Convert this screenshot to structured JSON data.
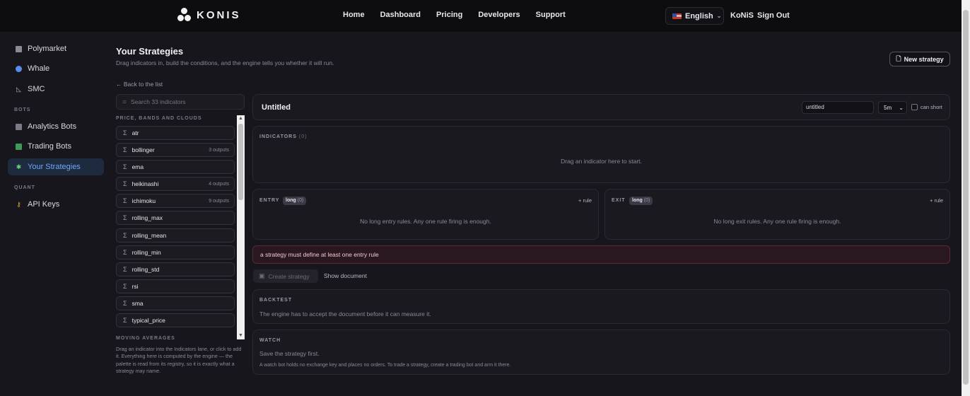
{
  "topbar": {
    "logo_text": "KONIS",
    "nav": [
      "Home",
      "Dashboard",
      "Pricing",
      "Developers",
      "Support"
    ],
    "language": "English",
    "user": "KoNiS",
    "sign_out": "Sign Out"
  },
  "sidebar": {
    "items_top": [
      {
        "label": "Polymarket",
        "icon": "polymarket-icon"
      },
      {
        "label": "Whale",
        "icon": "whale-icon"
      },
      {
        "label": "SMC",
        "icon": "smc-icon"
      }
    ],
    "section_bots": "BOTS",
    "items_bots": [
      {
        "label": "Analytics Bots",
        "icon": "analytics-icon"
      },
      {
        "label": "Trading Bots",
        "icon": "trading-icon"
      },
      {
        "label": "Your Strategies",
        "icon": "puzzle-icon",
        "active": true
      }
    ],
    "section_quant": "QUANT",
    "items_quant": [
      {
        "label": "API Keys",
        "icon": "key-icon"
      }
    ]
  },
  "header": {
    "title": "Your Strategies",
    "subtitle": "Drag indicators in, build the conditions, and the engine tells you whether it will run.",
    "back": "← Back to the list",
    "new_strategy": "New strategy"
  },
  "palette": {
    "search_placeholder": "Search 33 indicators",
    "group1": "PRICE, BANDS AND CLOUDS",
    "indicators": [
      {
        "name": "atr",
        "outputs": ""
      },
      {
        "name": "bollinger",
        "outputs": "3 outputs"
      },
      {
        "name": "ema",
        "outputs": ""
      },
      {
        "name": "heikinashi",
        "outputs": "4 outputs"
      },
      {
        "name": "ichimoku",
        "outputs": "9 outputs"
      },
      {
        "name": "rolling_max",
        "outputs": ""
      },
      {
        "name": "rolling_mean",
        "outputs": ""
      },
      {
        "name": "rolling_min",
        "outputs": ""
      },
      {
        "name": "rolling_std",
        "outputs": ""
      },
      {
        "name": "rsi",
        "outputs": ""
      },
      {
        "name": "sma",
        "outputs": ""
      },
      {
        "name": "typical_price",
        "outputs": ""
      }
    ],
    "group2": "MOVING AVERAGES",
    "note": "Drag an indicator into the Indicators lane, or click to add it. Everything here is computed by the engine — the palette is read from its registry, so it is exactly what a strategy may name."
  },
  "editor": {
    "name": "Untitled",
    "name_input": "untitled",
    "timeframe": "5m",
    "can_short": "can short",
    "indicators_label": "INDICATORS",
    "indicators_count": "(0)",
    "indicators_empty": "Drag an indicator here to start.",
    "entry_label": "ENTRY",
    "exit_label": "EXIT",
    "side_pill": "long",
    "side_count": "(0)",
    "add_rule": "+ rule",
    "entry_empty": "No long entry rules. Any one rule firing is enough.",
    "exit_empty": "No long exit rules. Any one rule firing is enough.",
    "error": "a strategy must define at least one entry rule",
    "create": "Create strategy",
    "show_document": "Show document",
    "backtest_label": "BACKTEST",
    "backtest_text": "The engine has to accept the document before it can measure it.",
    "watch_label": "WATCH",
    "watch_text": "Save the strategy first.",
    "watch_note": "A watch bot holds no exchange key and places no orders. To trade a strategy, create a trading bot and arm it there."
  }
}
